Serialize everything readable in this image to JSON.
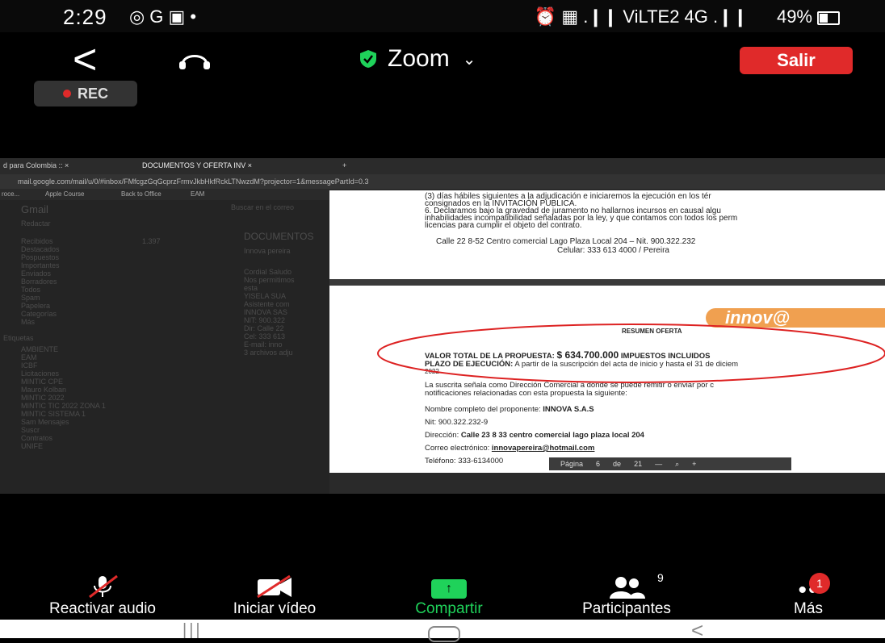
{
  "status_bar": {
    "time": "2:29",
    "left_icons": "◎ G ▣ •",
    "right_icons": "⏰ ▦ .❙❙ ViLTE2 4G .❙❙",
    "battery": "49%",
    "battery_level": 0.49
  },
  "header": {
    "back_glyph": "<",
    "title": "Zoom",
    "chevron": "⌄",
    "exit_label": "Salir",
    "rec_label": "REC"
  },
  "shared_screen": {
    "tabs": [
      "d para Colombia :: ×",
      "DOCUMENTOS Y OFERTA INV ×",
      "+"
    ],
    "url": "mail.google.com/mail/u/0/#inbox/FMfcgzGqGcprzFrmvJkbHkfRckLTNwzdM?projector=1&messagePartId=0.3",
    "bookmarks": [
      "roce...",
      "Apple Course",
      "Back to Office",
      "EAM"
    ],
    "gmail": {
      "app": "Gmail",
      "search": "Buscar en el correo",
      "compose": "Redactar",
      "folders": [
        "Recibidos",
        "Destacados",
        "Pospuestos",
        "Importantes",
        "Enviados",
        "Borradores",
        "Todos",
        "Spam",
        "Papelera",
        "Categorías",
        "Más"
      ],
      "labels_header": "Etiquetas",
      "labels": [
        "AMBIENTE",
        "EAM",
        "ICBF",
        "Licitaciones",
        "MINTIC CPE",
        "Mauro Kolban",
        "MINTIC 2022",
        "MINTIC TIC 2022 ZONA 1",
        "MINTIC SISTEMA 1",
        "Sam Mensajes",
        "Suscr",
        "Contratos",
        "UNIFE"
      ],
      "inbox_count": "1.397",
      "subject": "DOCUMENTOS",
      "sender": "Innova pereira",
      "body_lines": [
        "Cordial Saludo",
        "Nos permitimos",
        "esta",
        "YISELA SUA",
        "Asistente com",
        "INNOVA SAS",
        "NIT: 900.322",
        "Dir: Calle 22",
        "Cel: 333 613",
        "E-mail: inno",
        "3 archivos adju"
      ]
    },
    "pdf_page1": {
      "lines": [
        "(3) días hábiles siguientes a la adjudicación e iniciaremos la ejecución en los tér",
        "consignados en la INVITACIÓN PÚBLICA.",
        "6. Declaramos bajo la gravedad de juramento no hallarnos incursos en causal algu",
        "inhabilidades incompatibilidad señaladas por la ley, y que contamos con todos los perm",
        "licencias para cumplir el objeto del contrato."
      ],
      "footer_line1": "Calle 22 8-52 Centro comercial Lago Plaza Local 204 – Nit. 900.322.232",
      "footer_line2": "Celular: 333 613 4000 / Pereira"
    },
    "pdf_page2": {
      "logo": "innov@",
      "heading": "RESUMEN OFERTA",
      "total_label": "VALOR TOTAL DE LA PROPUESTA:",
      "total_value": "$ 634.700.000",
      "total_suffix": "IMPUESTOS INCLUIDOS",
      "plazo_label": "PLAZO DE EJECUCIÓN:",
      "plazo_text": "A partir de la suscripción del acta de inicio y hasta el 31 de diciem",
      "plazo_year": "2022",
      "notice_line1": "La suscrita señala como Dirección Comercial a donde se puede remitir o enviar por c",
      "notice_line2": "notificaciones relacionadas con esta propuesta la siguiente:",
      "proponent_label": "Nombre completo del proponente:",
      "proponent_value": "INNOVA S.A.S",
      "nit": "Nit: 900.322.232-9",
      "address_label": "Dirección:",
      "address_value": "Calle 23 8 33 centro comercial lago plaza local 204",
      "email_label": "Correo electrónico:",
      "email_value": "innovapereira@hotmail.com",
      "phone": "Teléfono: 333-6134000"
    },
    "pdf_toolbar": {
      "page_label": "Página",
      "page": "6",
      "of": "de",
      "total_pages": "21",
      "minus": "—",
      "zoom_icon": "⌕",
      "plus": "+"
    }
  },
  "toolbar": {
    "audio": "Reactivar audio",
    "video": "Iniciar vídeo",
    "share": "Compartir",
    "participants": "Participantes",
    "participants_count": "9",
    "more": "Más",
    "more_badge": "1"
  },
  "colors": {
    "accent_green": "#1fd25a",
    "exit_red": "#e02a2a"
  }
}
